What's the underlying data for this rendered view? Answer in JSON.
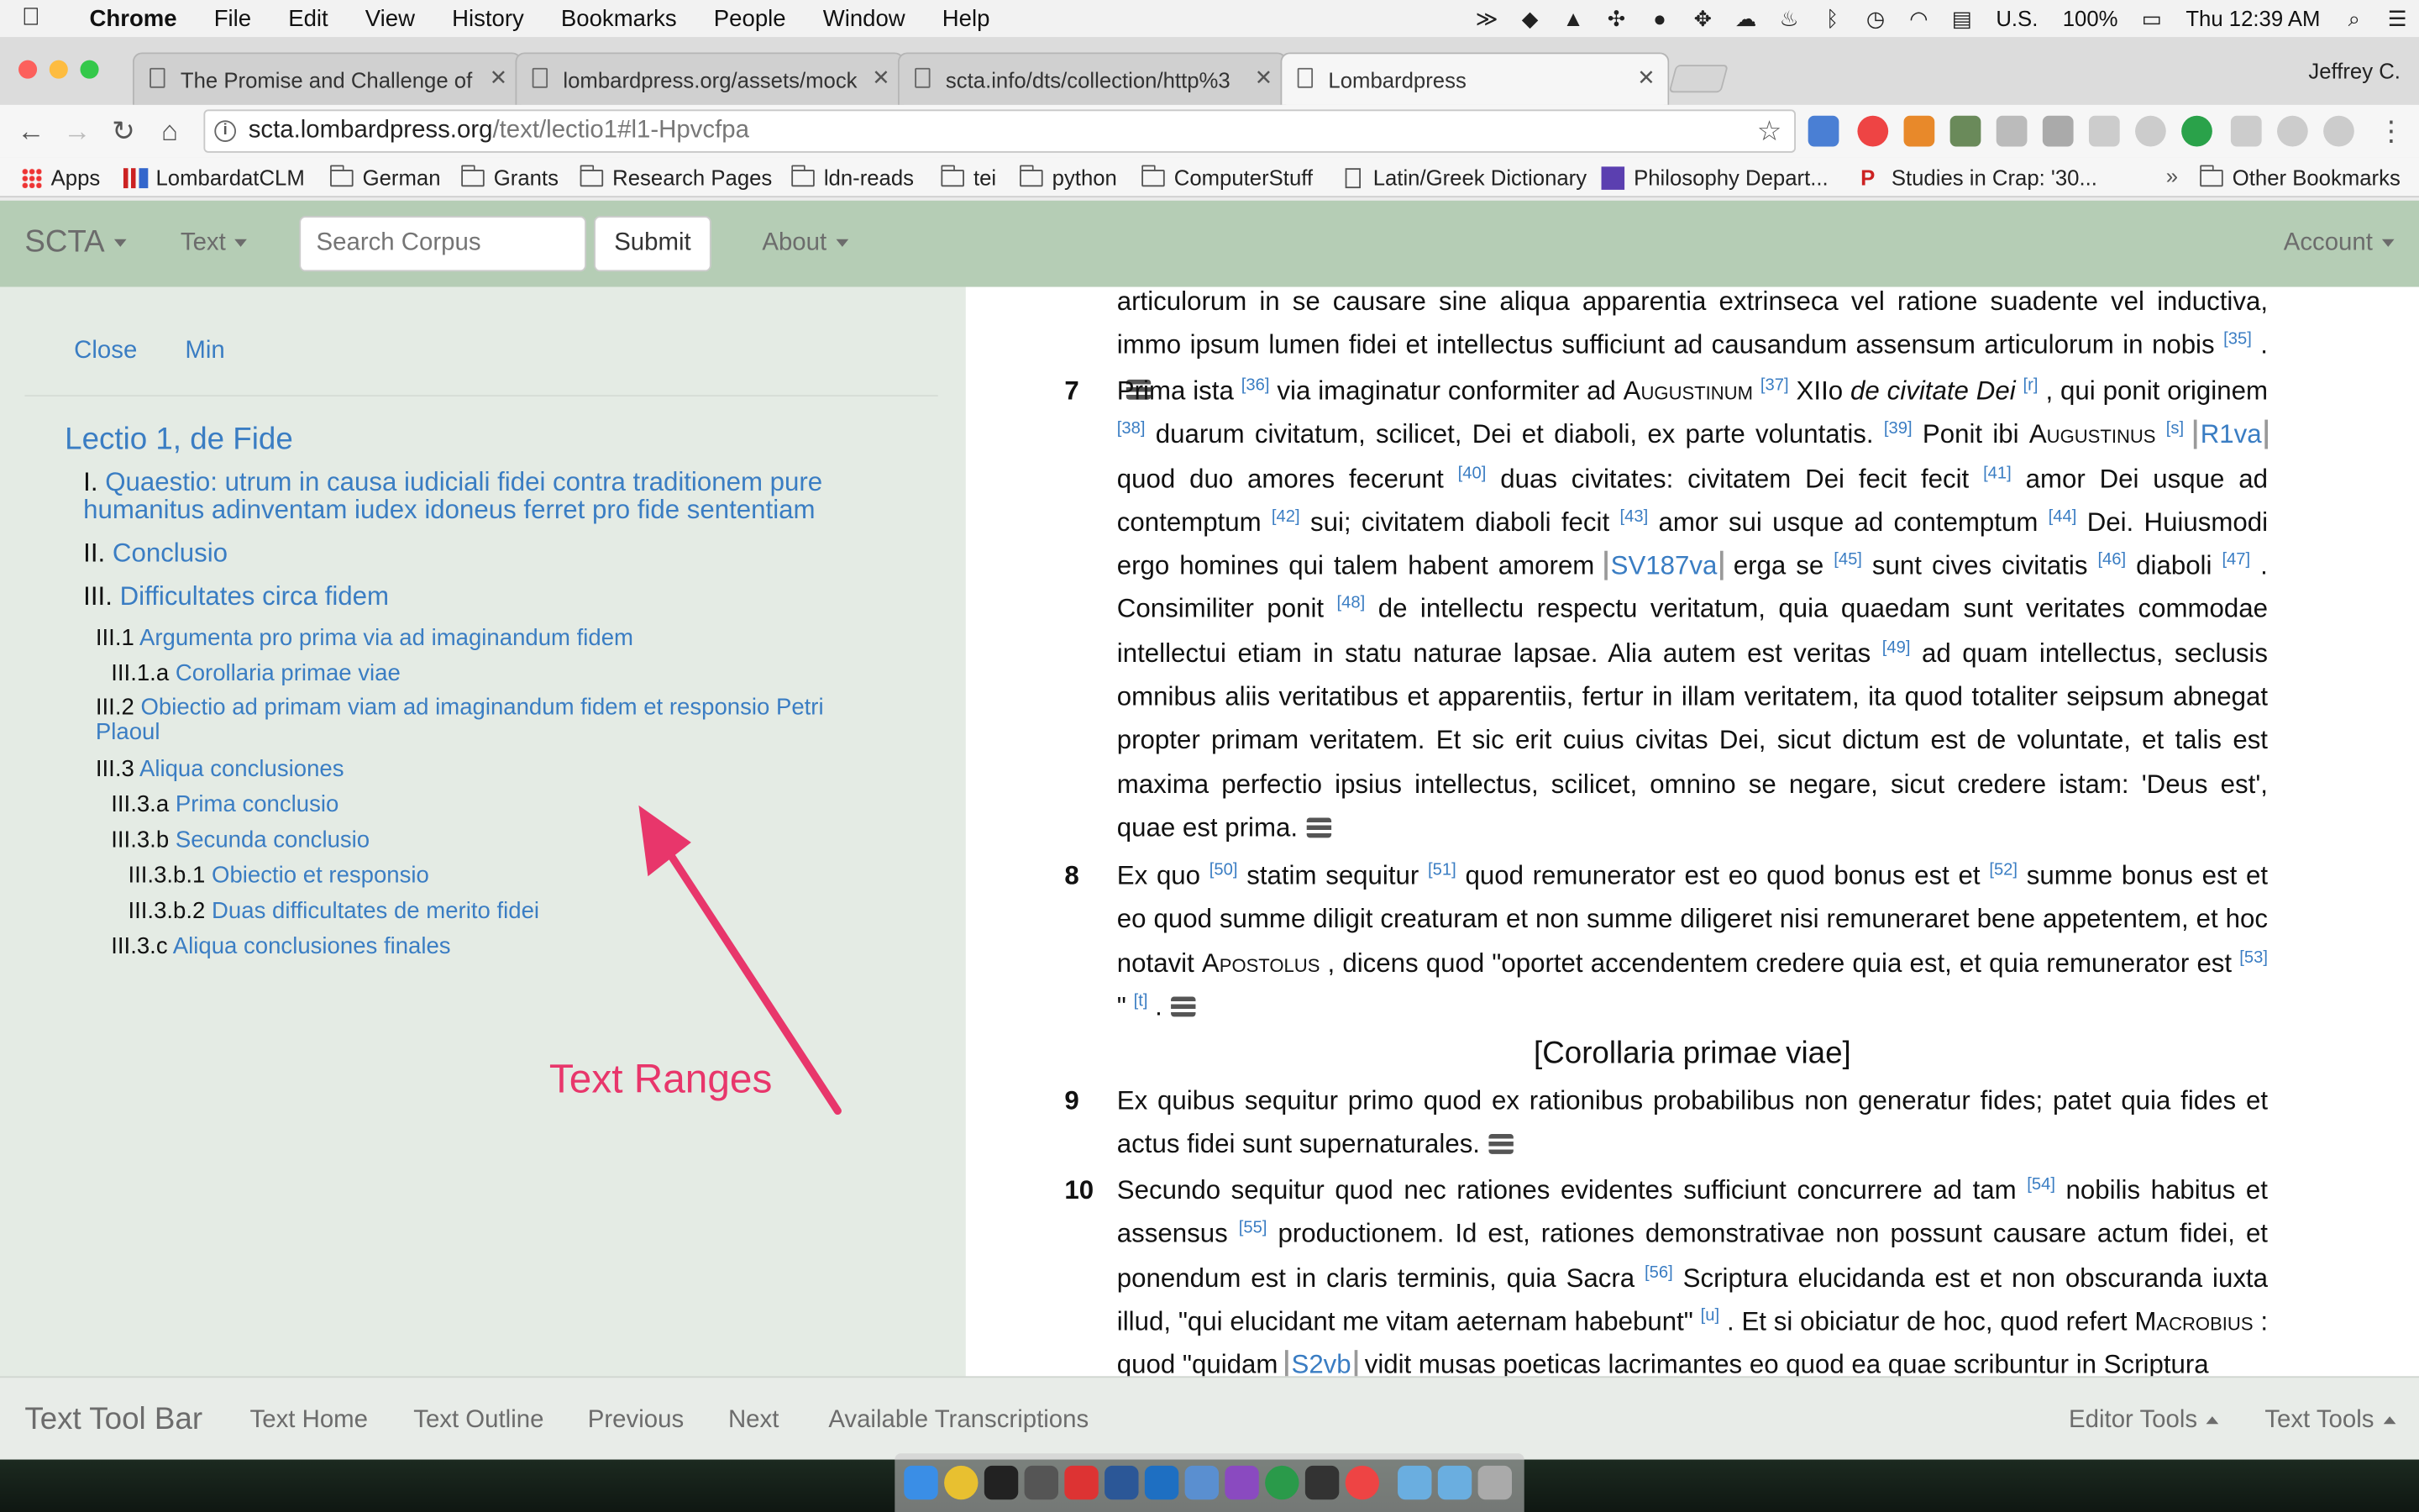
{
  "menubar": {
    "app": "Chrome",
    "items": [
      "File",
      "Edit",
      "View",
      "History",
      "Bookmarks",
      "People",
      "Window",
      "Help"
    ],
    "right": {
      "locale": "U.S.",
      "battery": "100%",
      "clock": "Thu 12:39 AM"
    }
  },
  "tabs": [
    {
      "label": "The Promise and Challenge of"
    },
    {
      "label": "lombardpress.org/assets/mock"
    },
    {
      "label": "scta.info/dts/collection/http%3"
    },
    {
      "label": "Lombardpress"
    }
  ],
  "profile": "Jeffrey C.",
  "url": {
    "host": "scta.lombardpress.org",
    "path": "/text/lectio1#l1-Hpvcfpa"
  },
  "bookmarks": [
    "Apps",
    "LombardatCLM",
    "German",
    "Grants",
    "Research Pages",
    "ldn-reads",
    "tei",
    "python",
    "ComputerStuff",
    "Latin/Greek Dictionary",
    "Philosophy Depart...",
    "Studies in Crap: '30...",
    "Other Bookmarks"
  ],
  "appnav": {
    "brand": "SCTA",
    "text_menu": "Text",
    "search_placeholder": "Search Corpus",
    "submit": "Submit",
    "about": "About",
    "account": "Account"
  },
  "left_panel": {
    "close": "Close",
    "min": "Min",
    "toc": [
      {
        "num": "",
        "title": "Lectio 1, de Fide"
      },
      {
        "num": "I.",
        "title": "Quaestio: utrum in causa iudiciali fidei contra traditionem pure humanitus adinventam iudex idoneus ferret pro fide sententiam"
      },
      {
        "num": "II.",
        "title": "Conclusio"
      },
      {
        "num": "III.",
        "title": "Difficultates circa fidem"
      },
      {
        "num": "III.1",
        "title": "Argumenta pro prima via ad imaginandum fidem"
      },
      {
        "num": "III.1.a",
        "title": "Corollaria primae viae"
      },
      {
        "num": "III.2",
        "title": "Obiectio ad primam viam ad imaginandum fidem et responsio Petri Plaoul"
      },
      {
        "num": "III.3",
        "title": "Aliqua conclusiones"
      },
      {
        "num": "III.3.a",
        "title": "Prima conclusio"
      },
      {
        "num": "III.3.b",
        "title": "Secunda conclusio"
      },
      {
        "num": "III.3.b.1",
        "title": "Obiectio et responsio"
      },
      {
        "num": "III.3.b.2",
        "title": "Duas difficultates de merito fidei"
      },
      {
        "num": "III.3.c",
        "title": "Aliqua conclusiones finales"
      }
    ],
    "annotation": "Text Ranges",
    "annotation_color": "#e8366b"
  },
  "text": {
    "para_cont": {
      "text1": "articulorum in se causare sine aliqua apparentia extrinseca vel ratione suadente vel inductiva, immo ipsum lumen fidei et intellectus sufficiunt ad causandum assensum articulorum in nobis",
      "n35": "[35]",
      "tail": "."
    },
    "p7": {
      "num": "7",
      "t1": "Prima ista",
      "n36": "[36]",
      "t2": "via imaginatur conformiter ad",
      "aug1": "Augustinum",
      "n37": "[37]",
      "t3": "XIIo",
      "civ": "de civitate Dei",
      "nr": "[r]",
      "t4": ", qui ponit originem",
      "n38": "[38]",
      "t5": "duarum civitatum, scilicet, Dei et diaboli, ex parte voluntatis.",
      "n39": "[39]",
      "t6": "Ponit ibi",
      "aug2": "Augustinus",
      "ns": "[s]",
      "ms1": "R1va",
      "t7": "quod duo amores fecerunt",
      "n40": "[40]",
      "t8": "duas civitates: civitatem Dei fecit fecit",
      "n41": "[41]",
      "t9": "amor Dei usque ad contemptum",
      "n42": "[42]",
      "t10": "sui; civitatem diaboli fecit",
      "n43": "[43]",
      "t11": "amor sui usque ad contemptum",
      "n44": "[44]",
      "t12": "Dei. Huiusmodi ergo homines qui talem habent amorem",
      "ms2": "SV187va",
      "t13": "erga se",
      "n45": "[45]",
      "t14": "sunt cives civitatis",
      "n46": "[46]",
      "t15": "diaboli",
      "n47": "[47]",
      "t16": ". Consimiliter ponit",
      "n48": "[48]",
      "t17": "de intellectu respectu veritatum, quia quaedam sunt veritates commodae intellectui etiam in statu naturae lapsae. Alia autem est veritas",
      "n49": "[49]",
      "t18": "ad quam intellectus, seclusis omnibus aliis veritatibus et apparentiis, fertur in illam veritatem, ita quod totaliter seipsum abnegat propter primam veritatem. Et sic erit cuius civitas Dei, sicut dictum est de voluntate, et talis est maxima perfectio ipsius intellectus, scilicet, omnino se negare, sicut credere istam: 'Deus est', quae est prima."
    },
    "p8": {
      "num": "8",
      "t1": "Ex quo",
      "n50": "[50]",
      "t2": "statim sequitur",
      "n51": "[51]",
      "t3": "quod remunerator est eo quod bonus est et",
      "n52": "[52]",
      "t4": "summe bonus est et eo quod summe diligit creaturam et non summe diligeret nisi remuneraret bene appetentem, et hoc notavit",
      "apost": "Apostolus",
      "t5": ", dicens quod \"oportet accendentem credere quia est, et quia remunerator est",
      "n53": "[53]",
      "t6": "\"",
      "nt": "[t]",
      "t7": "."
    },
    "heading": "[Corollaria primae viae]",
    "p9": {
      "num": "9",
      "t1": "Ex quibus sequitur primo quod ex rationibus probabilibus non generatur fides; patet quia fides et actus fidei sunt supernaturales."
    },
    "p10": {
      "num": "10",
      "t1": "Secundo sequitur quod nec rationes evidentes sufficiunt concurrere ad tam",
      "n54": "[54]",
      "t2": "nobilis habitus et assensus",
      "n55": "[55]",
      "t3": "productionem. Id est, rationes demonstrativae non possunt causare actum fidei, et ponendum est in claris terminis, quia Sacra",
      "n56": "[56]",
      "t4": "Scriptura elucidanda est et non obscuranda iuxta illud, \"qui elucidant me vitam aeternam habebunt\"",
      "nu": "[u]",
      "t5": ". Et si obiciatur de hoc, quod refert",
      "macro": "Macrobius",
      "t6": ": quod \"quidam",
      "ms3": "S2vb",
      "t7": "vidit musas poeticas lacrimantes eo quod ea quae scribuntur in Scriptura"
    }
  },
  "bottombar": {
    "title": "Text Tool Bar",
    "links": [
      "Text Home",
      "Text Outline",
      "Previous",
      "Next",
      "Available Transcriptions"
    ],
    "editor_tools": "Editor Tools",
    "text_tools": "Text Tools"
  }
}
